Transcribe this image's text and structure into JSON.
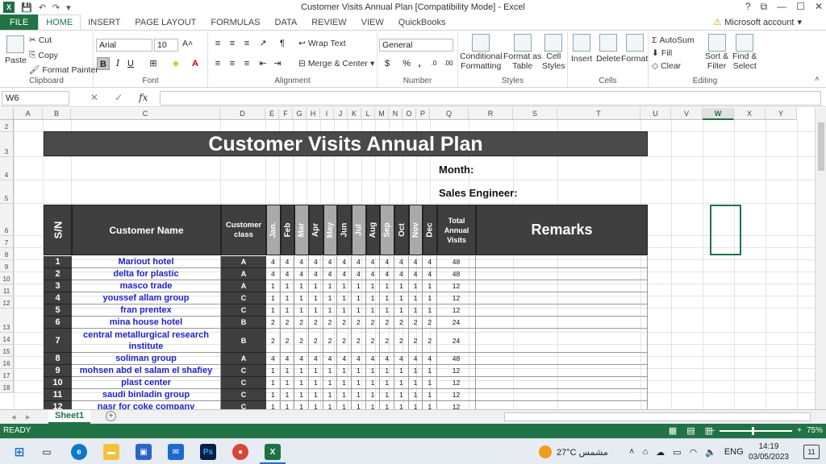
{
  "window": {
    "title": "Customer Visits Annual Plan  [Compatibility Mode] - Excel",
    "logo": "X",
    "help": "?",
    "controls": [
      "⧉",
      "—",
      "☐",
      "✕"
    ]
  },
  "quick_access": [
    "save-icon",
    "undo-icon",
    "redo-icon"
  ],
  "ribbon_tabs": [
    "FILE",
    "HOME",
    "INSERT",
    "PAGE LAYOUT",
    "FORMULAS",
    "DATA",
    "REVIEW",
    "VIEW",
    "QuickBooks"
  ],
  "active_tab": "HOME",
  "account": "Microsoft account",
  "ribbon": {
    "clipboard": {
      "label": "Clipboard",
      "paste": "Paste",
      "cut": "Cut",
      "copy": "Copy",
      "format_painter": "Format Painter"
    },
    "font": {
      "label": "Font",
      "name": "Arial",
      "size": "10",
      "grow": "A˄",
      "shrink": "A˅",
      "bold": "B",
      "italic": "I",
      "underline": "U"
    },
    "alignment": {
      "label": "Alignment",
      "wrap": "Wrap Text",
      "merge": "Merge & Center"
    },
    "number": {
      "label": "Number",
      "format": "General",
      "percent": "%",
      "comma": ","
    },
    "styles": {
      "label": "Styles",
      "conditional": "Conditional",
      "conditional2": "Formatting",
      "format_as": "Format as",
      "format_as2": "Table",
      "cell_styles": "Cell",
      "cell_styles2": "Styles"
    },
    "cells": {
      "label": "Cells",
      "insert": "Insert",
      "delete": "Delete",
      "format": "Format"
    },
    "editing": {
      "label": "Editing",
      "autosum": "AutoSum",
      "fill": "Fill",
      "clear": "Clear",
      "sort": "Sort &",
      "sort2": "Filter",
      "find": "Find &",
      "find2": "Select"
    }
  },
  "formula_bar": {
    "name_box": "W6",
    "value": ""
  },
  "columns": [
    "A",
    "B",
    "C",
    "D",
    "E",
    "F",
    "G",
    "H",
    "I",
    "J",
    "K",
    "L",
    "M",
    "N",
    "O",
    "P",
    "Q",
    "R",
    "S",
    "T",
    "U",
    "V",
    "W",
    "X",
    "Y"
  ],
  "selected_column": "W",
  "row_numbers": [
    "2",
    "3",
    "4",
    "5",
    "6",
    "7",
    "8",
    "9",
    "10",
    "11",
    "12",
    "13",
    "14",
    "15",
    "16",
    "17",
    "18"
  ],
  "sheet": {
    "title": "Customer Visits Annual Plan",
    "month_label": "Month:",
    "engineer_label": "Sales Engineer:",
    "headers": {
      "sn": "S/N",
      "name": "Customer Name",
      "class": "Customer class",
      "total": "Total Annual Visits",
      "remarks": "Remarks"
    },
    "months": [
      "Jan.",
      "Feb",
      "Mar",
      "Apr",
      "May",
      "Jun",
      "Jul",
      "Aug",
      "Sep",
      "Oct",
      "Nov",
      "Dec"
    ],
    "rows": [
      {
        "sn": "1",
        "name": "Mariout hotel",
        "class": "A",
        "v": "4",
        "total": "48"
      },
      {
        "sn": "2",
        "name": "delta for plastic",
        "class": "A",
        "v": "4",
        "total": "48"
      },
      {
        "sn": "3",
        "name": "masco trade",
        "class": "A",
        "v": "1",
        "total": "12"
      },
      {
        "sn": "4",
        "name": "youssef allam group",
        "class": "C",
        "v": "1",
        "total": "12"
      },
      {
        "sn": "5",
        "name": "fran prentex",
        "class": "C",
        "v": "1",
        "total": "12"
      },
      {
        "sn": "6",
        "name": "mina house hotel",
        "class": "B",
        "v": "2",
        "total": "24"
      },
      {
        "sn": "7",
        "name": "central metallurgical research institute",
        "class": "B",
        "v": "2",
        "total": "24"
      },
      {
        "sn": "8",
        "name": "soliman group",
        "class": "A",
        "v": "4",
        "total": "48"
      },
      {
        "sn": "9",
        "name": "mohsen abd el salam el shafiey",
        "class": "C",
        "v": "1",
        "total": "12"
      },
      {
        "sn": "10",
        "name": "plast center",
        "class": "C",
        "v": "1",
        "total": "12"
      },
      {
        "sn": "11",
        "name": "saudi binladin group",
        "class": "C",
        "v": "1",
        "total": "12"
      },
      {
        "sn": "12",
        "name": "nasr for coke company",
        "class": "C",
        "v": "1",
        "total": "12"
      }
    ]
  },
  "sheet_tabs": [
    "Sheet1"
  ],
  "status": {
    "ready": "READY",
    "zoom": "75%"
  },
  "taskbar": {
    "weather": "27°C  مشمس",
    "lang": "ENG",
    "time": "14:19",
    "date": "03/05/2023",
    "notifications": "11"
  }
}
